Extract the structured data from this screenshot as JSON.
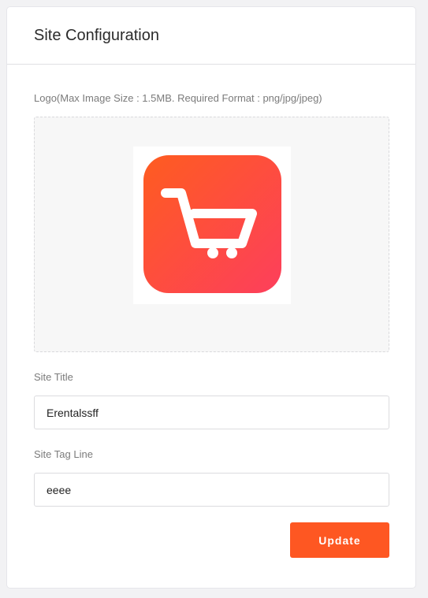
{
  "page": {
    "title": "Site Configuration"
  },
  "logo": {
    "label": "Logo(Max Image Size : 1.5MB. Required Format : png/jpg/jpeg)",
    "icon": "shopping-cart-icon",
    "gradient_start": "#fe5c20",
    "gradient_end": "#fd3f5c"
  },
  "site_title": {
    "label": "Site Title",
    "value": "Erentalssff"
  },
  "site_tagline": {
    "label": "Site Tag Line",
    "value": "eeee"
  },
  "actions": {
    "update_label": "Update",
    "accent_color": "#fe5722"
  }
}
